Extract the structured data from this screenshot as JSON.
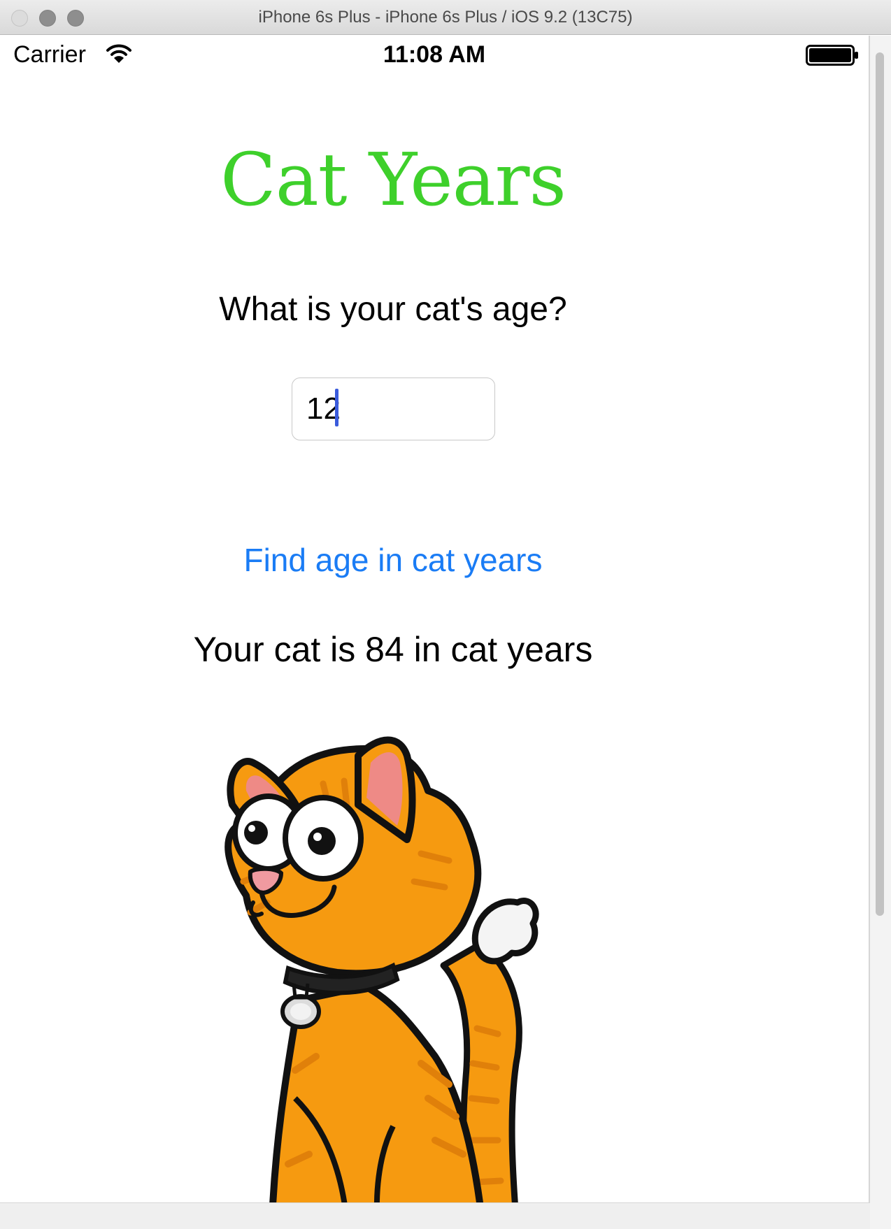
{
  "window": {
    "title": "iPhone 6s Plus - iPhone 6s Plus / iOS 9.2 (13C75)"
  },
  "status_bar": {
    "carrier": "Carrier",
    "time": "11:08 AM",
    "icons": [
      "wifi-icon",
      "battery-icon"
    ]
  },
  "app": {
    "title": "Cat Years",
    "title_color": "#3ed02b",
    "question": "What is your cat's age?",
    "age_input_value": "12",
    "find_button_label": "Find age in cat years",
    "find_button_color": "#1a7cf5",
    "result": "Your cat is 84 in cat years",
    "image": "cartoon-orange-cat"
  }
}
